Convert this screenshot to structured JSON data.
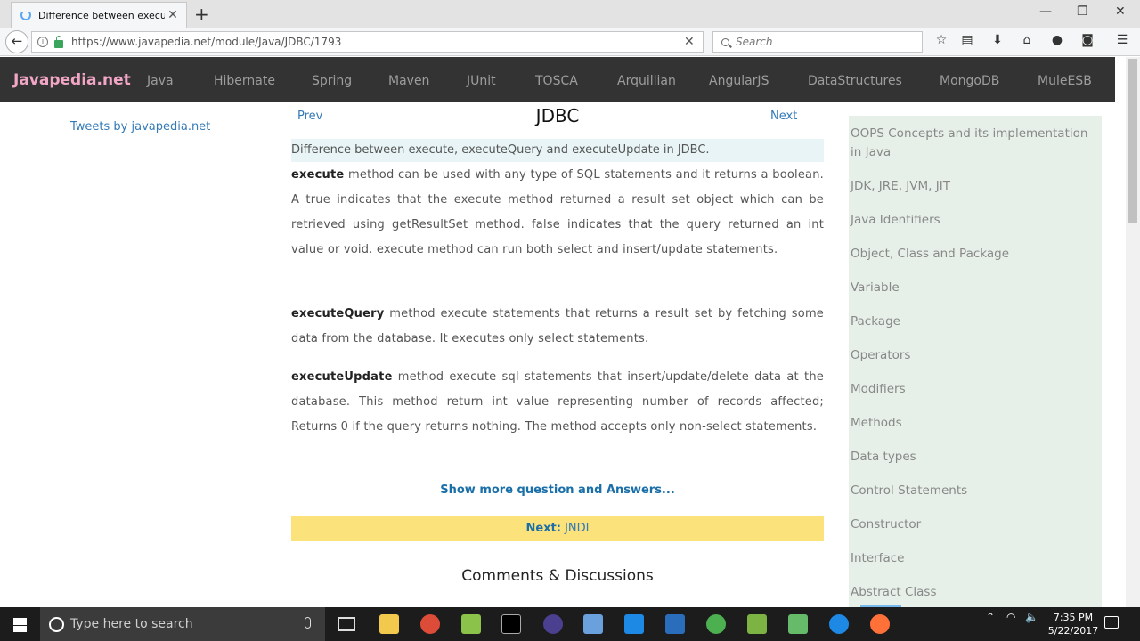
{
  "browser": {
    "tab_title": "Difference between execut...",
    "new_tab": "+",
    "tab_close": "✕",
    "url": "https://www.javapedia.net/module/Java/JDBC/1793",
    "search_placeholder": "Search",
    "window_minimize": "—",
    "window_restore": "❐",
    "window_close": "✕"
  },
  "site": {
    "brand": "Javapedia.net",
    "nav": [
      "Java",
      "Hibernate",
      "Spring",
      "Maven",
      "JUnit",
      "TOSCA",
      "Arquillian",
      "AngularJS",
      "DataStructures",
      "MongoDB",
      "MuleESB"
    ]
  },
  "page": {
    "tweets": "Tweets by javapedia.net",
    "prev": "Prev",
    "next": "Next",
    "title": "JDBC",
    "question": "Difference between execute, executeQuery and executeUpdate in JDBC.",
    "answers": [
      {
        "term": "execute",
        "text": " method can be used with any type of SQL statements and it returns a boolean. A true indicates that the execute method returned a result set object which can be retrieved using getResultSet method. false indicates that the query returned an int value or void. execute method can run both select and insert/update statements."
      },
      {
        "term": "executeQuery",
        "text": " method execute statements that returns a result set by fetching some data from the database. It executes only select statements."
      },
      {
        "term": "executeUpdate",
        "text": " method execute sql statements that insert/update/delete data at the database. This method return int value representing number of records affected; Returns 0 if the query returns nothing. The method accepts only non-select statements."
      }
    ],
    "show_more": "Show more question and Answers...",
    "next_label": "Next:",
    "next_value": " JNDI",
    "comments": "Comments & Discussions"
  },
  "sidebar": {
    "items": [
      "OOPS Concepts and its implementation in Java",
      "JDK, JRE, JVM, JIT",
      "Java Identifiers",
      "Object, Class and Package",
      "Variable",
      "Package",
      "Operators",
      "Modifiers",
      "Methods",
      "Data types",
      "Control Statements",
      "Constructor",
      "Interface",
      "Abstract Class"
    ]
  },
  "taskbar": {
    "search_placeholder": "Type here to search",
    "time": "7:35 PM",
    "date": "5/22/2017"
  },
  "colors": {
    "header_bg": "#333333",
    "brand": "#f2a6c6",
    "link": "#337ab7",
    "next_bar": "#fbe27b",
    "sidebar_bg": "#e6f0e8"
  }
}
